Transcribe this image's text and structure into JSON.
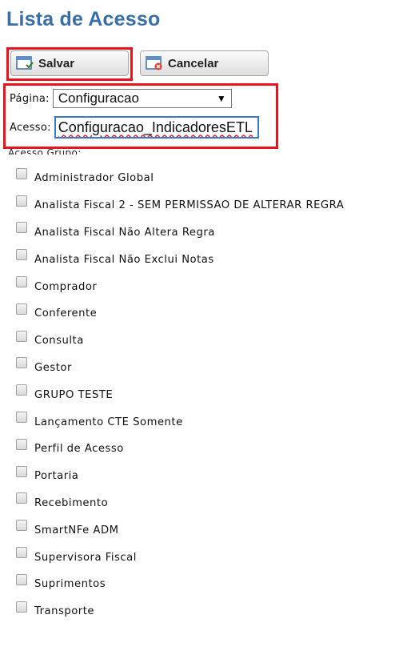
{
  "page_title": "Lista de Acesso",
  "toolbar": {
    "save_label": "Salvar",
    "cancel_label": "Cancelar"
  },
  "form": {
    "pagina_label": "Página:",
    "pagina_value": "Configuracao",
    "acesso_label": "Acesso:",
    "acesso_value": "Configuracao_IndicadoresETL",
    "grupo_label": "Acesso Grupo:"
  },
  "groups": [
    {
      "label": "Administrador Global",
      "checked": false
    },
    {
      "label": "Analista Fiscal 2 - SEM PERMISSAO DE ALTERAR REGRA",
      "checked": false
    },
    {
      "label": "Analista Fiscal Não Altera Regra",
      "checked": false
    },
    {
      "label": "Analista Fiscal Não Exclui Notas",
      "checked": false
    },
    {
      "label": "Comprador",
      "checked": false
    },
    {
      "label": "Conferente",
      "checked": false
    },
    {
      "label": "Consulta",
      "checked": false
    },
    {
      "label": "Gestor",
      "checked": false
    },
    {
      "label": "GRUPO TESTE",
      "checked": false
    },
    {
      "label": "Lançamento CTE Somente",
      "checked": false
    },
    {
      "label": "Perfil de Acesso",
      "checked": false
    },
    {
      "label": "Portaria",
      "checked": false
    },
    {
      "label": "Recebimento",
      "checked": false
    },
    {
      "label": "SmartNFe ADM",
      "checked": false
    },
    {
      "label": "Supervisora Fiscal",
      "checked": false
    },
    {
      "label": "Suprimentos",
      "checked": false
    },
    {
      "label": "Transporte",
      "checked": false
    }
  ],
  "colors": {
    "title": "#3a6ea8",
    "highlight": "#e8141b",
    "input_border": "#3a78c8"
  }
}
